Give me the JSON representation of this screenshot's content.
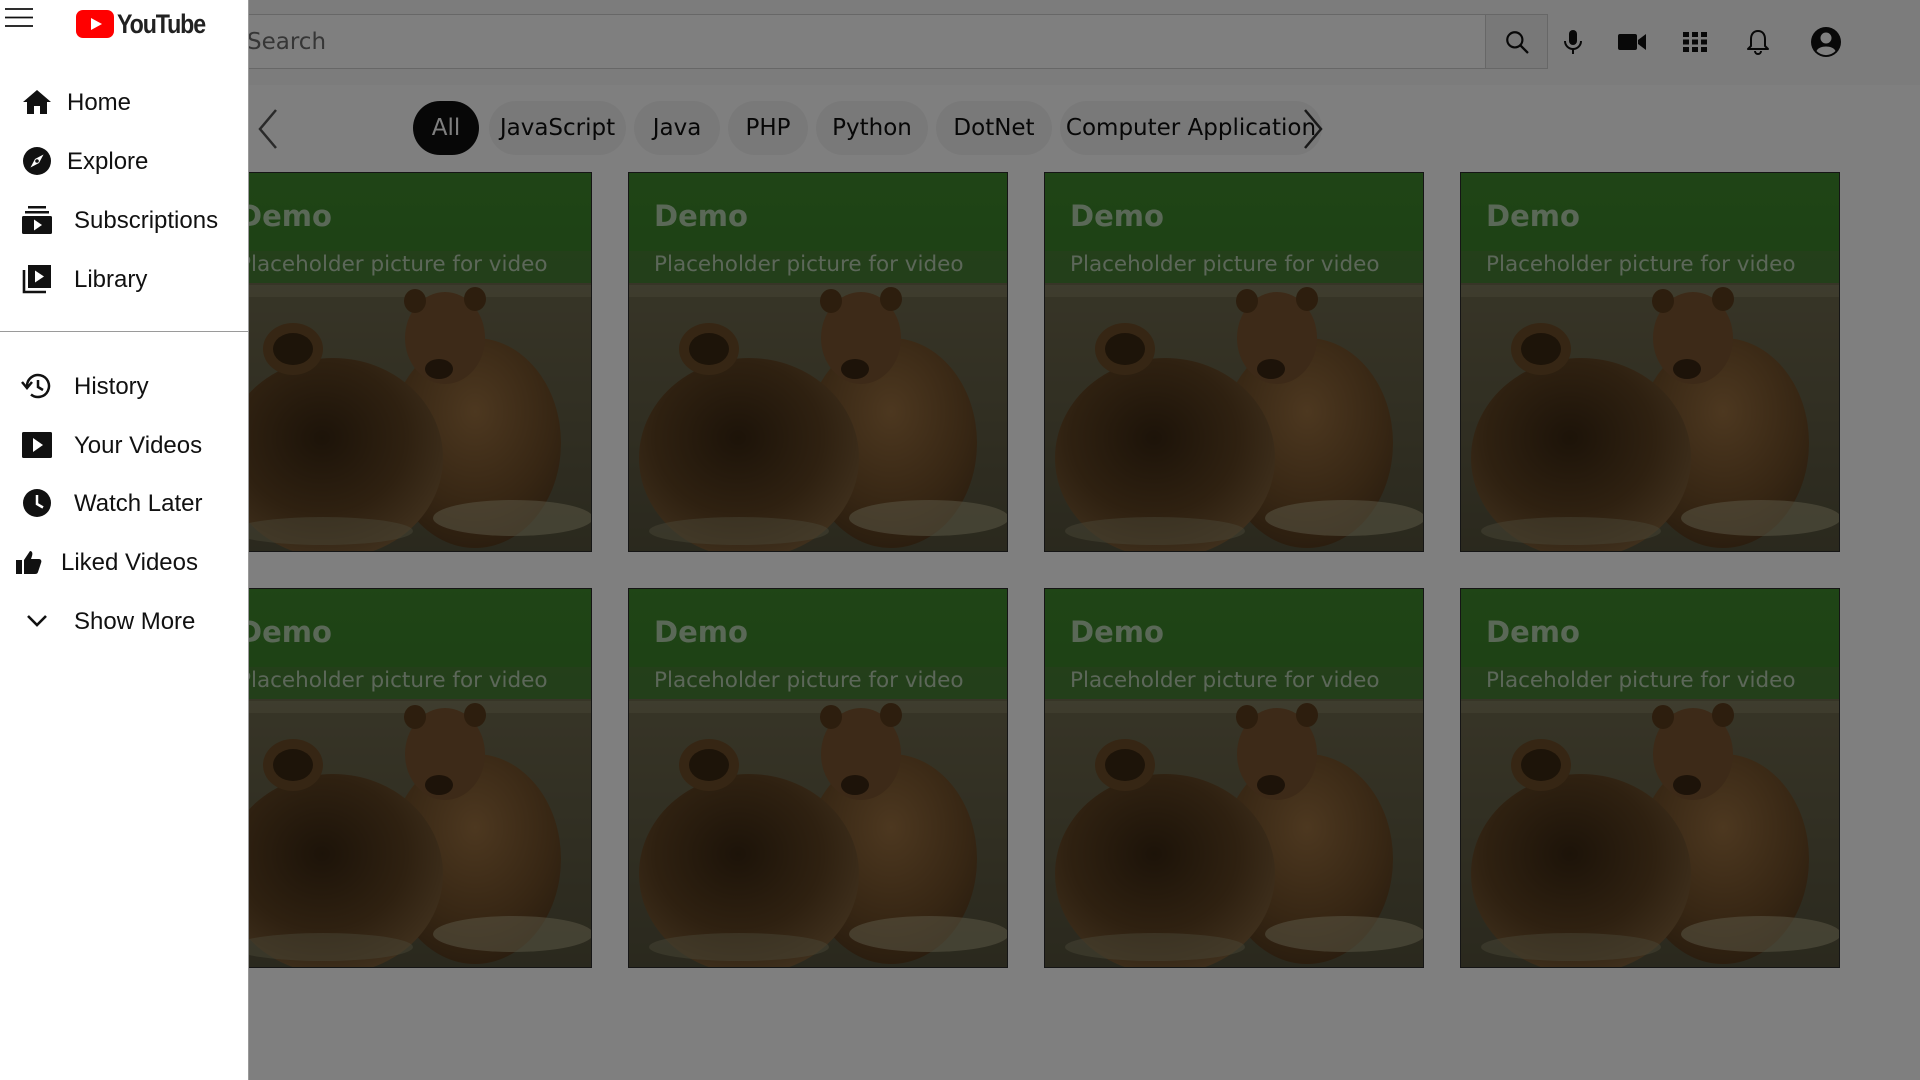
{
  "app": {
    "logo_text": "YouTube"
  },
  "header": {
    "search": {
      "placeholder": "Search",
      "value": ""
    },
    "icons": [
      "search-icon",
      "microphone-icon",
      "video-camera-icon",
      "apps-grid-icon",
      "bell-icon",
      "account-icon"
    ]
  },
  "chips": [
    "All",
    "JavaScript",
    "Java",
    "PHP",
    "Python",
    "DotNet",
    "Computer Application"
  ],
  "active_chip": "All",
  "videos": [
    {
      "title": "Demo",
      "subtitle": "Placeholder picture for video"
    },
    {
      "title": "Demo",
      "subtitle": "Placeholder picture for video"
    },
    {
      "title": "Demo",
      "subtitle": "Placeholder picture for video"
    },
    {
      "title": "Demo",
      "subtitle": "Placeholder picture for video"
    },
    {
      "title": "Demo",
      "subtitle": "Placeholder picture for video"
    },
    {
      "title": "Demo",
      "subtitle": "Placeholder picture for video"
    },
    {
      "title": "Demo",
      "subtitle": "Placeholder picture for video"
    },
    {
      "title": "Demo",
      "subtitle": "Placeholder picture for video"
    }
  ],
  "sidebar": {
    "primary": [
      {
        "label": "Home",
        "icon": "home-icon"
      },
      {
        "label": "Explore",
        "icon": "compass-icon"
      },
      {
        "label": "Subscriptions",
        "icon": "subscriptions-icon"
      },
      {
        "label": "Library",
        "icon": "library-icon"
      }
    ],
    "secondary": [
      {
        "label": "History",
        "icon": "history-icon"
      },
      {
        "label": "Your Videos",
        "icon": "your-videos-icon"
      },
      {
        "label": "Watch Later",
        "icon": "clock-icon"
      },
      {
        "label": "Liked Videos",
        "icon": "thumbs-up-icon"
      },
      {
        "label": "Show More",
        "icon": "chevron-down-icon"
      }
    ]
  },
  "colors": {
    "brand_red": "#ff0000",
    "overlay": "#000000",
    "active_chip": "#0f0f0f"
  }
}
